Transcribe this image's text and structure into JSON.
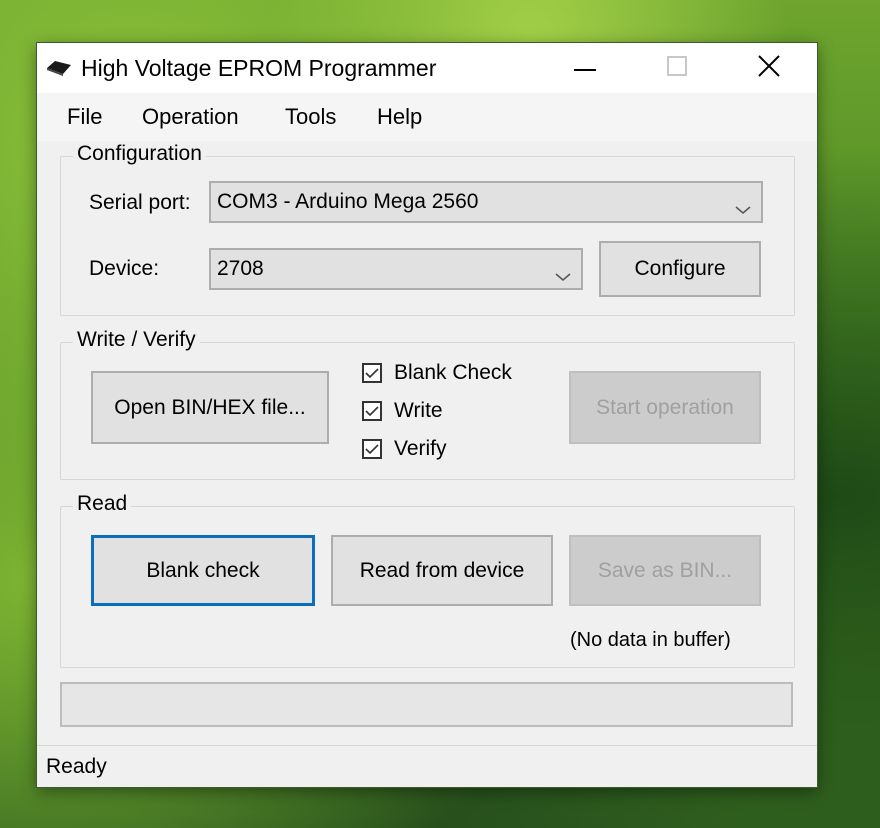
{
  "window": {
    "title": "High Voltage EPROM Programmer",
    "app_icon": "chip-icon",
    "controls": {
      "minimize": "minimize-icon",
      "maximize": "maximize-icon",
      "close": "close-icon"
    }
  },
  "menu": {
    "items": [
      {
        "label": "File"
      },
      {
        "label": "Operation"
      },
      {
        "label": "Tools"
      },
      {
        "label": "Help"
      }
    ]
  },
  "configuration": {
    "title": "Configuration",
    "serial_port_label": "Serial port:",
    "serial_port_value": "COM3 - Arduino Mega 2560",
    "device_label": "Device:",
    "device_value": "2708",
    "configure_button": "Configure"
  },
  "write_verify": {
    "title": "Write / Verify",
    "open_button": "Open BIN/HEX file...",
    "checkboxes": [
      {
        "label": "Blank Check",
        "checked": true
      },
      {
        "label": "Write",
        "checked": true
      },
      {
        "label": "Verify",
        "checked": true
      }
    ],
    "start_button": "Start operation",
    "start_enabled": false
  },
  "read": {
    "title": "Read",
    "blank_check_button": "Blank check",
    "read_button": "Read from device",
    "save_button": "Save as BIN...",
    "save_enabled": false,
    "buffer_note": "(No data in buffer)"
  },
  "progress": {
    "value_percent": 0
  },
  "status": {
    "text": "Ready"
  }
}
